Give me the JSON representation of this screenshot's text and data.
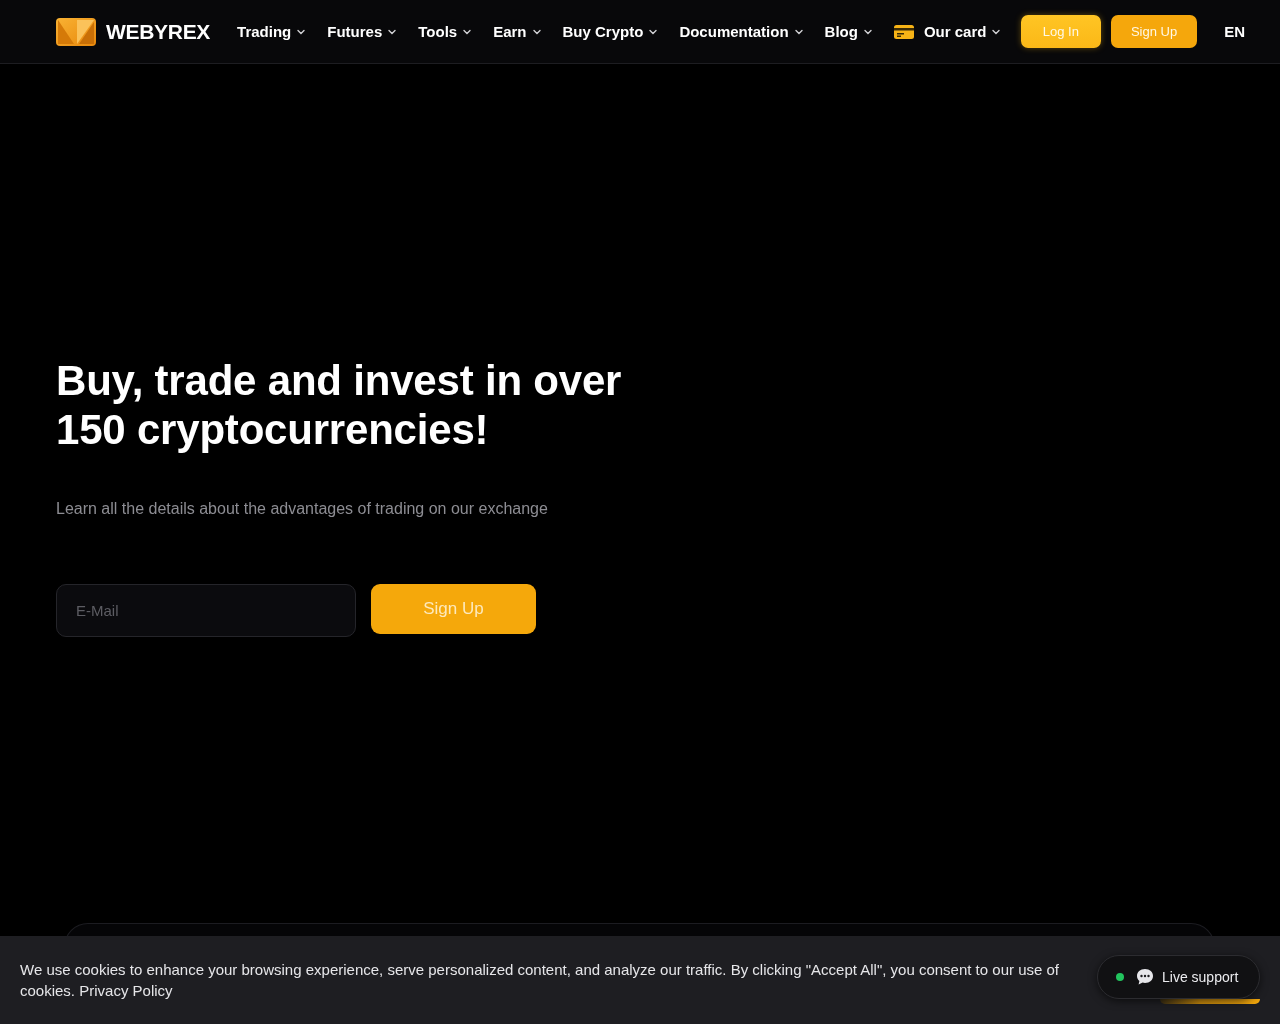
{
  "header": {
    "logo_text": "WEBYREX",
    "nav": [
      {
        "label": "Trading",
        "kind": "menu"
      },
      {
        "label": "Futures",
        "kind": "menu"
      },
      {
        "label": "Tools",
        "kind": "menu"
      },
      {
        "label": "Earn",
        "kind": "menu"
      },
      {
        "label": "Buy Crypto",
        "kind": "menu"
      },
      {
        "label": "Documentation",
        "kind": "menu"
      },
      {
        "label": "Blog",
        "kind": "menu"
      },
      {
        "label": "Our card",
        "kind": "card"
      }
    ],
    "buttons": [
      {
        "label": "Log In",
        "kind": "login"
      },
      {
        "label": "Sign Up",
        "kind": "signup"
      }
    ],
    "language": "EN"
  },
  "hero": {
    "title": "Buy, trade and invest in over 150 cryptocurrencies!",
    "subtitle": "Learn all the details about the advantages of trading on our exchange",
    "email": {
      "placeholder": "E-Mail"
    },
    "button": "Sign Up"
  },
  "cookie_banner": {
    "text": "We use cookies to enhance your browsing experience, serve personalized content, and analyze our traffic. By clicking \"Accept All\", you consent to our use of cookies.",
    "link": "Privacy Policy"
  },
  "live_support": {
    "label": "Live support",
    "online": true
  }
}
